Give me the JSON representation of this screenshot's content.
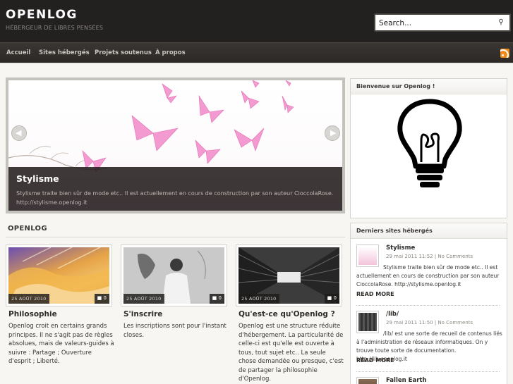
{
  "header": {
    "title": "OPENLOG",
    "tagline": "HÉBERGEUR DE LIBRES PENSÉES",
    "search_placeholder": "Search..."
  },
  "nav": {
    "items": [
      {
        "label": "Accueil"
      },
      {
        "label": "Sites hébergés"
      },
      {
        "label": "Projets soutenus"
      },
      {
        "label": "À propos"
      }
    ],
    "rss_icon": "rss-icon"
  },
  "slider": {
    "title": "Stylisme",
    "text": "Stylisme traite bien sûr de mode etc.. Il est actuellement en cours de construction par son auteur CioccolaRose. http://stylisme.openlog.it",
    "prev_icon": "chevron-left-icon",
    "next_icon": "chevron-right-icon"
  },
  "section": {
    "title": "OPENLOG"
  },
  "posts": [
    {
      "date": "25 AOÛT 2010",
      "comments": "0",
      "title": "Philosophie",
      "text": "Openlog croit en certains grands principes. Il ne s'agit pas de règles absolues, mais de valeurs-guides à suivre : Partage ; Ouverture d'esprit ; Liberté."
    },
    {
      "date": "25 AOÛT 2010",
      "comments": "0",
      "title": "S'inscrire",
      "text": "Les inscriptions sont pour l'instant closes."
    },
    {
      "date": "25 AOÛT 2010",
      "comments": "0",
      "title": "Qu'est-ce qu'Openlog ?",
      "text": "Openlog est une structure réduite d'hébergement. La particularité de celle-ci  est qu'elle est ouverte à tous, tout sujet etc.. La seule chose demandée ou presque, c'est de partager la philosophie d'Openlog."
    }
  ],
  "sidebar": {
    "welcome_title": "Bienvenue sur Openlog !",
    "recent_title": "Derniers sites hébergés",
    "recent": [
      {
        "title": "Stylisme",
        "meta": "29 mai 2011 11:52 | No Comments",
        "text": "Stylisme traite bien sûr de mode etc.. Il est actuellement en cours de construction par son auteur CioccolaRose. http://stylisme.openlog.it",
        "read_more": "READ MORE"
      },
      {
        "title": "/lib/",
        "meta": "29 mai 2011 11:50 | No Comments",
        "text": "/lib/ est une sorte de recueil de contenus liés à l'administration de réseaux informatiques. On y trouve toute sorte de documentation. http://lib.openlog.it",
        "read_more": "READ MORE"
      },
      {
        "title": "Fallen Earth"
      }
    ]
  },
  "colors": {
    "header_bg": "#232020",
    "nav_bg": "#2f2c2a",
    "page_bg": "#f7f6f3",
    "rss": "#f28a1c"
  }
}
